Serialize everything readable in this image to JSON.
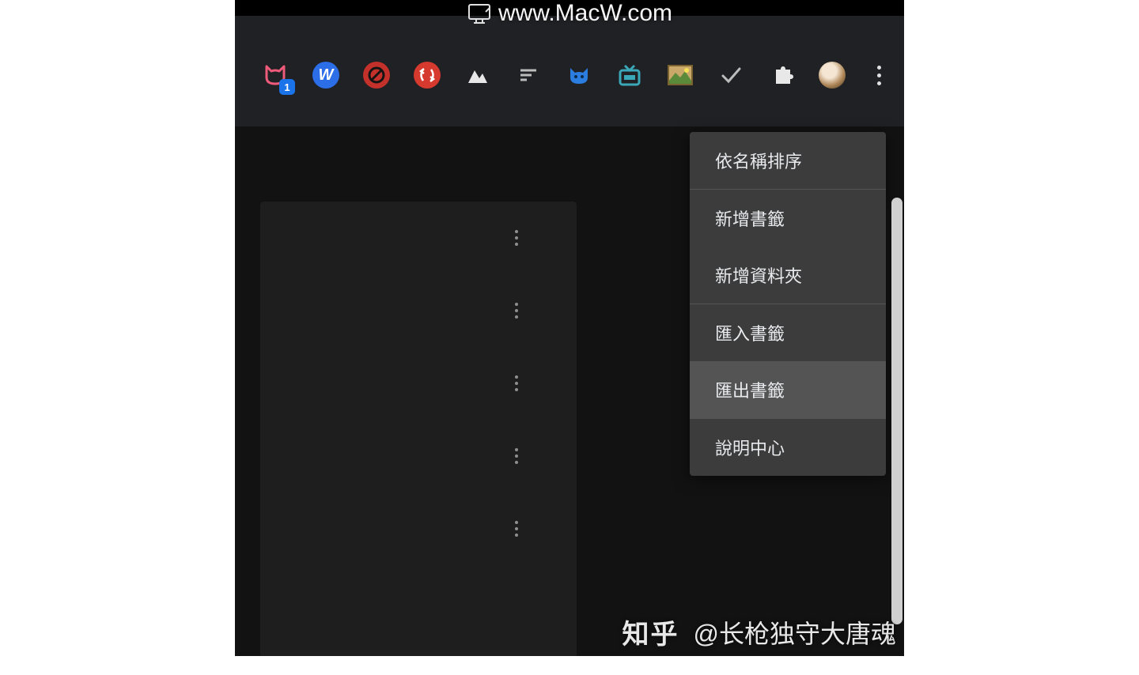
{
  "watermark_top": "www.MacW.com",
  "toolbar": {
    "badge_count": "1"
  },
  "menu": {
    "sort_by_name": "依名稱排序",
    "add_bookmark": "新增書籤",
    "add_folder": "新增資料夾",
    "import_bookmarks": "匯入書籤",
    "export_bookmarks": "匯出書籤",
    "help_center": "說明中心"
  },
  "bottom_watermark": {
    "platform": "知乎",
    "author": "@长枪独守大唐魂"
  }
}
